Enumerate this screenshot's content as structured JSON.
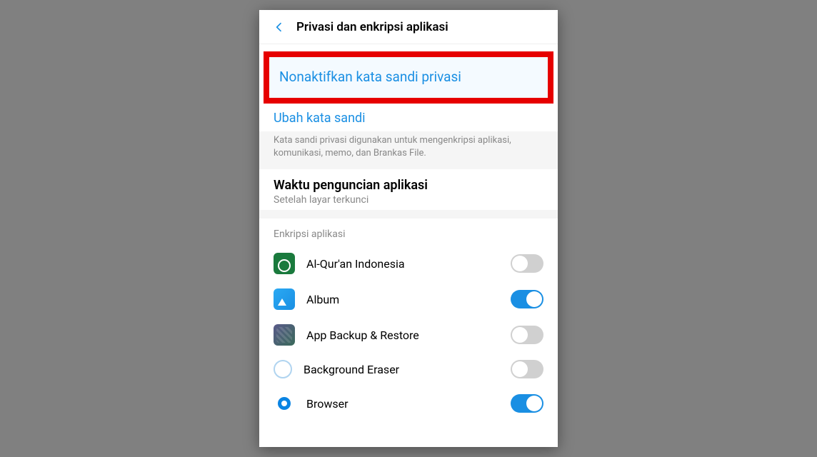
{
  "header": {
    "title": "Privasi dan enkripsi aplikasi"
  },
  "actions": {
    "disable_password": "Nonaktifkan kata sandi privasi",
    "change_password": "Ubah kata sandi"
  },
  "description": "Kata sandi privasi digunakan untuk mengenkripsi aplikasi, komunikasi, memo, dan Brankas File.",
  "lock_time": {
    "title": "Waktu penguncian aplikasi",
    "subtitle": "Setelah layar terkunci"
  },
  "list_header": "Enkripsi aplikasi",
  "apps": [
    {
      "name": "Al-Qur'an Indonesia",
      "enabled": false,
      "icon": "ic-quran"
    },
    {
      "name": "Album",
      "enabled": true,
      "icon": "ic-album"
    },
    {
      "name": "App Backup & Restore",
      "enabled": false,
      "icon": "ic-backup"
    },
    {
      "name": "Background Eraser",
      "enabled": false,
      "icon": "ic-eraser"
    },
    {
      "name": "Browser",
      "enabled": true,
      "icon": "ic-browser"
    }
  ]
}
